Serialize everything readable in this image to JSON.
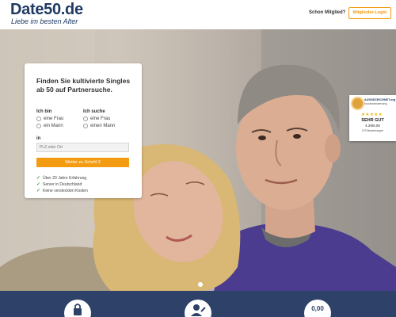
{
  "header": {
    "logo": "Date50.de",
    "tagline": "Liebe im besten Alter",
    "member_question": "Schon Mitglied?",
    "login_label": "Mitglieder-Login"
  },
  "signup": {
    "title": "Finden Sie kultivierte Singles ab 50 auf Partnersuche.",
    "i_am_label": "Ich bin",
    "i_am_options": [
      "eine Frau",
      "ein Mann"
    ],
    "seeking_label": "Ich suche",
    "seeking_options": [
      "eine Frau",
      "einen Mann"
    ],
    "location_label": "in",
    "location_placeholder": "PLZ oder Ort",
    "next_label": "Weiter zu Schritt 2",
    "features": [
      "Über 20 Jahre Erfahrung",
      "Server in Deutschland",
      "Keine versteckten Kosten"
    ]
  },
  "rating": {
    "brand": "AUSGEZEICHNET.org",
    "sub": "Kundenbewertung",
    "stars": "★★★★★",
    "grade": "SEHR GUT",
    "score": "4.29/5.00",
    "count": "279 Bewertungen"
  },
  "band": {
    "price_text": "0,00"
  },
  "colors": {
    "brand_navy": "#1f3a63",
    "accent_orange": "#f39c12",
    "band_navy": "#2d4169"
  }
}
